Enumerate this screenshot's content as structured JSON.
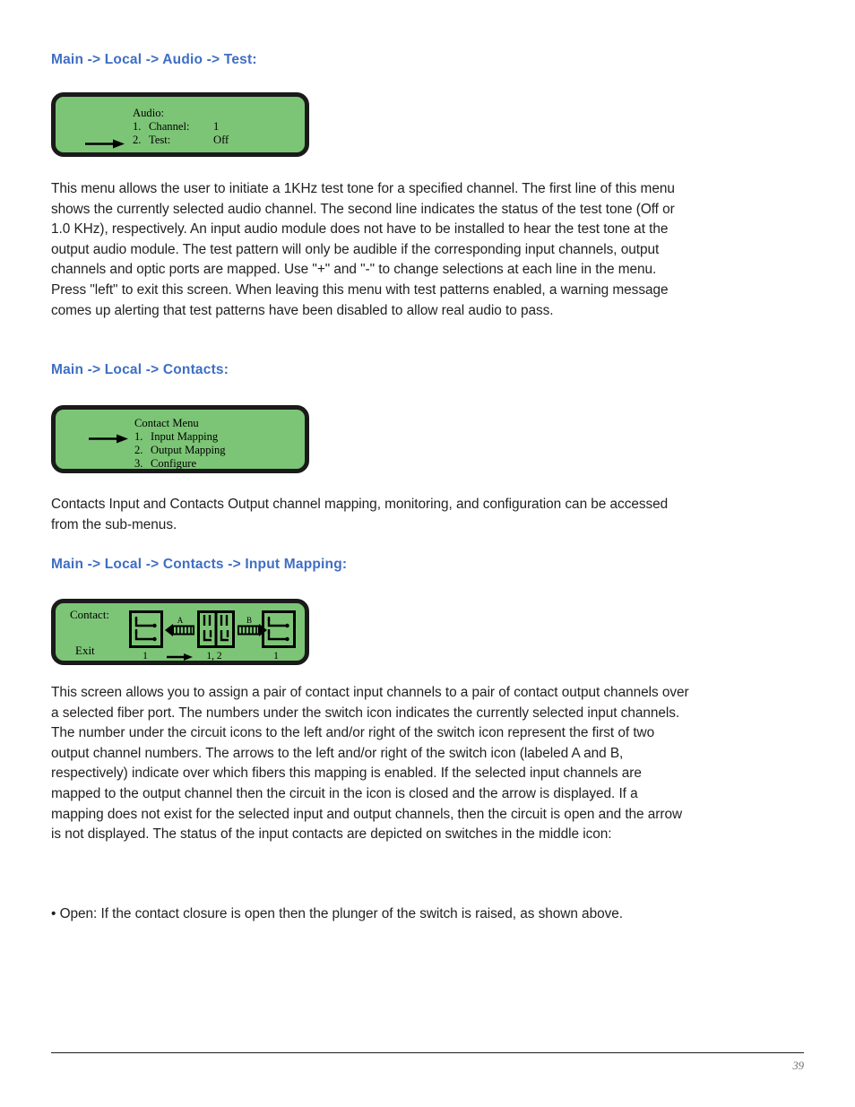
{
  "document": {
    "page_number": "39"
  },
  "sections": [
    {
      "heading": "Main -> Local -> Audio -> Test:",
      "panel": {
        "kind": "lcd-menu",
        "title": "Audio:",
        "rows": [
          {
            "index": "1.",
            "label": "Channel:",
            "value": "1",
            "selected": false
          },
          {
            "index": "2.",
            "label": "Test:",
            "value": "Off",
            "selected": true
          }
        ]
      },
      "paragraph": "This menu allows the user to initiate a 1KHz test tone for a specified channel. The first line of this menu shows the currently selected audio channel. The second line indicates the status of the test tone (Off or 1.0 KHz), respectively. An input audio module does not have to be installed to hear the test tone at the output audio module. The test pattern will only be audible if the corresponding input channels, output channels and optic ports are mapped. Use \"+\" and \"-\" to change selections at each line in the menu. Press \"left\" to exit this screen. When leaving this menu with test patterns enabled, a warning message comes up alerting that test patterns have been disabled to allow real audio to pass."
    },
    {
      "heading": "Main -> Local -> Contacts:",
      "panel": {
        "kind": "lcd-menu",
        "title": "Contact Menu",
        "rows": [
          {
            "index": "1.",
            "label": "Input Mapping",
            "value": "",
            "selected": true
          },
          {
            "index": "2.",
            "label": "Output Mapping",
            "value": "",
            "selected": false
          },
          {
            "index": "3.",
            "label": "Configure",
            "value": "",
            "selected": false
          }
        ]
      },
      "paragraph": "Contacts Input and Contacts Output channel mapping, monitoring, and configuration can be accessed from the sub-menus."
    },
    {
      "heading": "Main -> Local -> Contacts -> Input Mapping:",
      "panel": {
        "kind": "lcd-mapping",
        "label": "Contact:",
        "exit_label": "Exit",
        "left_circuit_number": "1",
        "switch_number": "1, 2",
        "right_circuit_number": "1",
        "arrow_a_label": "A",
        "arrow_b_label": "B"
      },
      "paragraph": "This screen allows you to assign a pair of contact input channels to a pair of contact output channels over a selected fiber port. The numbers under the switch icon indicates the currently selected input channels. The number under the circuit icons to the left and/or right of the switch icon represent the first of two output channel numbers. The arrows to the left and/or right of the switch icon (labeled A and B, respectively) indicate over which fibers this mapping is enabled. If the selected input channels are mapped to the output channel then the circuit in the icon is closed and the arrow is displayed. If a mapping does not exist for the selected input and output channels, then the circuit is open and the arrow is not displayed. The status of the input contacts are depicted on switches in the middle icon:",
      "bullet": "• Open: If the contact closure is open then the plunger of the switch is raised, as shown above."
    }
  ],
  "colors": {
    "heading_blue": "#3f6ec4",
    "lcd_green": "#7cc576",
    "lcd_border": "#1a1a1a",
    "body_text": "#231f20",
    "page_number": "#6d6e71"
  }
}
